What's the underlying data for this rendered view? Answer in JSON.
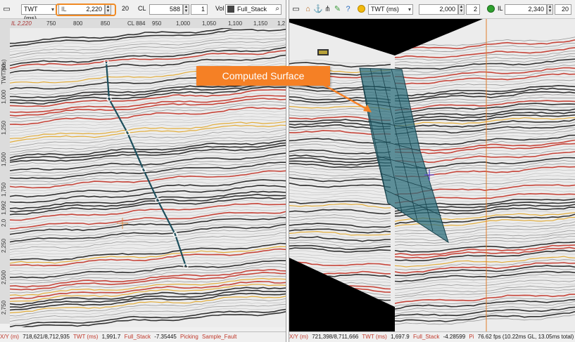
{
  "left": {
    "toolbar": {
      "domain_select": "TWT (ms)",
      "inline_label": "IL",
      "inline_value": "2,220",
      "inline_step": "20",
      "crossline_label": "CL",
      "crossline_value": "588",
      "crossline_step": "1",
      "volume_label": "Vol",
      "volume_value": "Full_Stack"
    },
    "axis_top": {
      "inline_tag": "IL 2,220",
      "crossline_tag": "CL 884",
      "ticks": [
        "750",
        "800",
        "850",
        "950",
        "1,000",
        "1,050",
        "1,100",
        "1,150",
        "1,2"
      ]
    },
    "axis_left": {
      "title": "TWT (ms)",
      "ticks": [
        "750",
        "1,000",
        "1,250",
        "1,500",
        "1,750",
        "1,992",
        "2,0",
        "2,250",
        "2,500",
        "2,750"
      ]
    },
    "status": {
      "xy_label": "X/Y (m)",
      "xy_value": "718,621/8,712,935",
      "twt_label": "TWT (ms)",
      "twt_value": "1,991.7",
      "vol_label": "Full_Stack",
      "vol_value": "-7.35445",
      "mode_label": "Picking",
      "mode_value": "Sample_Fault"
    }
  },
  "right": {
    "toolbar": {
      "domain_select": "TWT (ms)",
      "value_a": "2,000",
      "step_a": "2",
      "inline_label": "IL",
      "inline_value": "2,340",
      "inline_step": "20"
    },
    "status": {
      "xy_label": "X/Y (m)",
      "xy_value": "721,398/8,711,666",
      "twt_label": "TWT (ms)",
      "twt_value": "1,697.9",
      "vol_label": "Full_Stack",
      "vol_value": "-4.28599",
      "mode_label": "Pi",
      "fps": "76.62 fps (10.22ms GL, 13.05ms total)"
    }
  },
  "callout": {
    "text": "Computed Surface"
  },
  "colors": {
    "accent": "#f58025",
    "fault": "#1d4f5c",
    "surface": "#2d6f7c",
    "status_label": "#c0392b"
  }
}
